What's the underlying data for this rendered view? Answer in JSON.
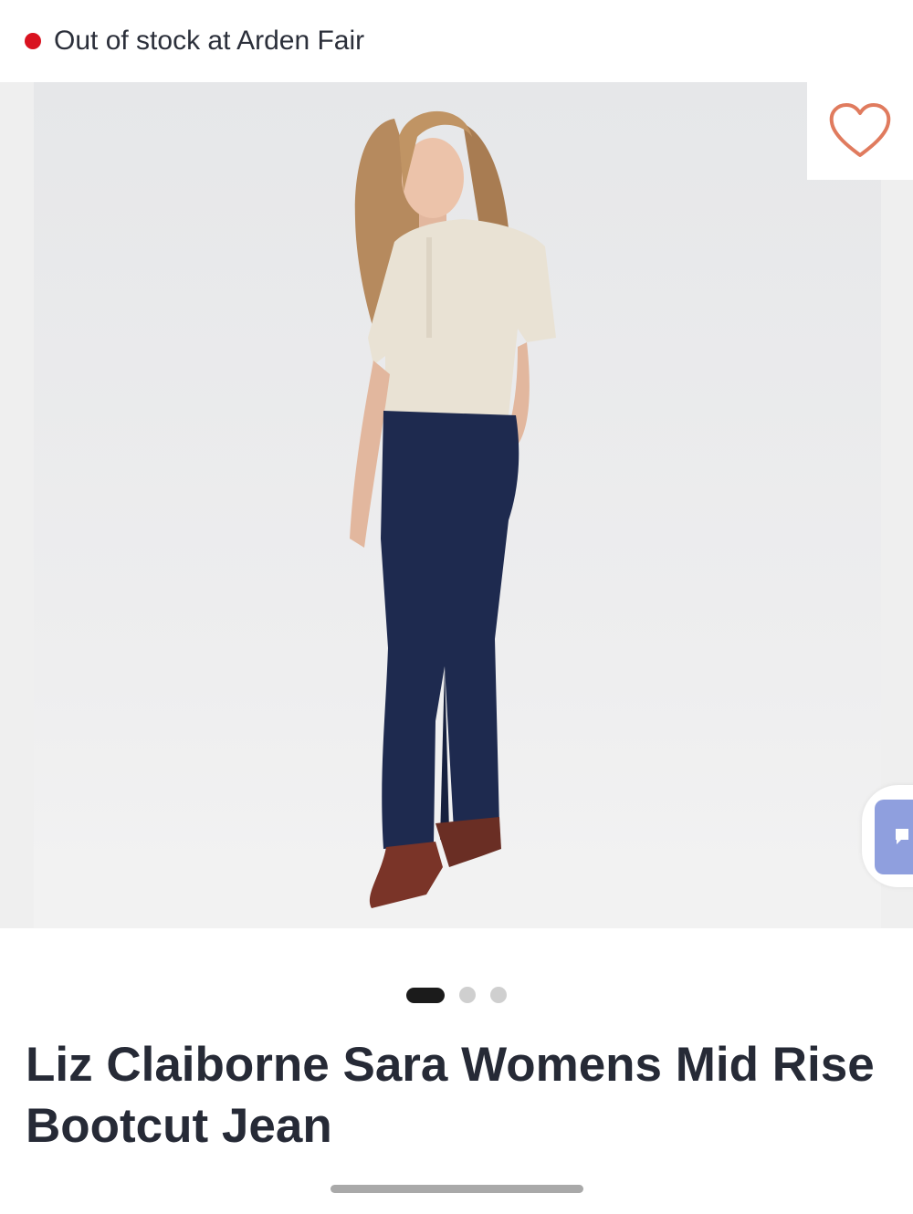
{
  "store_status": {
    "text": "Out of stock at Arden Fair",
    "indicator_color": "#d9121f"
  },
  "gallery": {
    "image_alt": "Model wearing cream short-sleeve henley top, dark wash bootcut jeans and brown ankle boots",
    "favorite_icon": "heart-outline-icon",
    "total_images": 3,
    "active_index": 0
  },
  "product": {
    "title": "Liz Claiborne Sara Womens Mid Rise Bootcut Jean"
  },
  "colors": {
    "accent": "#e07b5e",
    "side_tab": "#8f9fde"
  }
}
